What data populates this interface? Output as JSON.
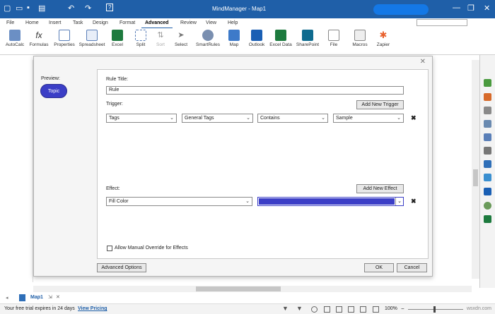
{
  "window": {
    "title": "MindManager - Map1",
    "icons": [
      "new-icon",
      "open-icon",
      "save-icon",
      "print-icon",
      "undo-icon",
      "redo-icon",
      "help-icon"
    ],
    "help_glyph": "?",
    "brand_color": "#1f5fa8"
  },
  "menu": {
    "items": [
      "File",
      "Home",
      "Insert",
      "Task",
      "Design",
      "Format",
      "Advanced",
      "Review",
      "View",
      "Help"
    ],
    "active": "Advanced"
  },
  "ribbon": {
    "buttons": [
      {
        "label": "AutoCalc",
        "icon": "autocalc-icon"
      },
      {
        "label": "Formulas",
        "icon": "fx-icon"
      },
      {
        "label": "Properties",
        "icon": "properties-icon"
      },
      {
        "label": "Spreadsheet",
        "icon": "spreadsheet-icon"
      },
      {
        "label": "Excel",
        "icon": "excel-icon"
      },
      {
        "label": "Split",
        "icon": "split-icon"
      },
      {
        "label": "Sort",
        "icon": "sort-icon"
      },
      {
        "label": "Select",
        "icon": "select-icon"
      },
      {
        "label": "SmartRules",
        "icon": "smartrules-icon"
      },
      {
        "label": "Map",
        "icon": "map-icon"
      },
      {
        "label": "Outlook",
        "icon": "outlook-icon"
      },
      {
        "label": "Excel Data",
        "icon": "excel-data-icon"
      },
      {
        "label": "SharePoint",
        "icon": "sharepoint-icon"
      },
      {
        "label": "File",
        "icon": "file-icon"
      },
      {
        "label": "Macros",
        "icon": "macros-icon"
      },
      {
        "label": "Zapier",
        "icon": "zapier-icon"
      }
    ]
  },
  "dialog": {
    "preview_label": "Preview:",
    "topic_label": "Topic",
    "rule_title_label": "Rule Title:",
    "rule_title_value": "Rule",
    "trigger_label": "Trigger:",
    "add_trigger": "Add New Trigger",
    "trigger": {
      "field": "Tags",
      "group": "General Tags",
      "operator": "Contains",
      "value": "Sample"
    },
    "effect_label": "Effect:",
    "add_effect": "Add New Effect",
    "effect": {
      "field": "Fill Color",
      "color": "#3b3ec6"
    },
    "remove_glyph": "✖",
    "override_label": "Allow Manual Override for Effects",
    "advanced_options": "Advanced Options",
    "ok": "OK",
    "cancel": "Cancel",
    "close_glyph": "✕"
  },
  "doc_tab": {
    "label": "Map1"
  },
  "status": {
    "trial_text": "Your free trial expires in 24 days",
    "view_pricing": "View Pricing",
    "zoom": "100%"
  },
  "watermark": "wsxdn.com"
}
